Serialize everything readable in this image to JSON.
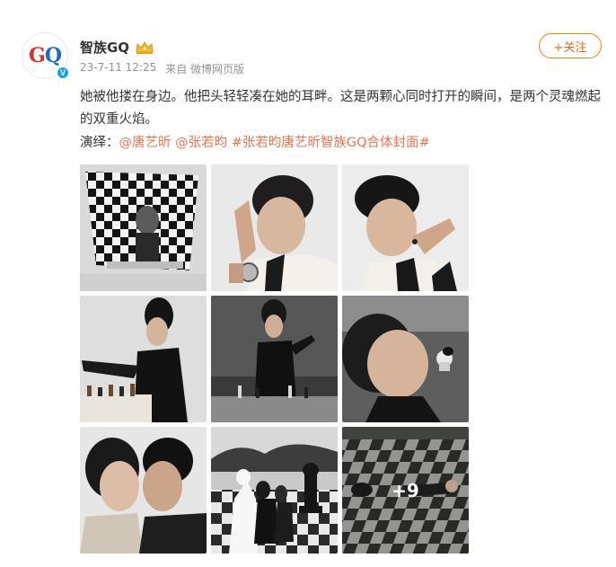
{
  "author": {
    "name": "智族GQ",
    "avatar_text": "GQ",
    "verified_badge": "V"
  },
  "meta": {
    "time": "23-7-11 12:25",
    "source": "来自 微博网页版"
  },
  "follow_button": "+关注",
  "post": {
    "text": "她被他搂在身边。他把头轻轻凑在她的耳畔。这是两颗心同时打开的瞬间，是两个灵魂燃起的双重火焰。",
    "credits_label": "演绎：",
    "mention_1": "@唐艺昕",
    "mention_2": "@张若昀",
    "hashtag": "#张若昀唐艺昕智族GQ合体封面#"
  },
  "gallery": {
    "more_count": "+9",
    "images": [
      "chessboard-portrait-icon",
      "man-hand-watch-icon",
      "man-earring-icon",
      "woman-chess-table-icon",
      "woman-dark-room-icon",
      "woman-chess-piece-icon",
      "couple-kiss-icon",
      "couple-giant-chess-icon",
      "outdoor-chessboard-icon"
    ]
  },
  "colors": {
    "link": "#eb7350",
    "follow": "#f08300",
    "text": "#333333",
    "meta": "#939393"
  }
}
